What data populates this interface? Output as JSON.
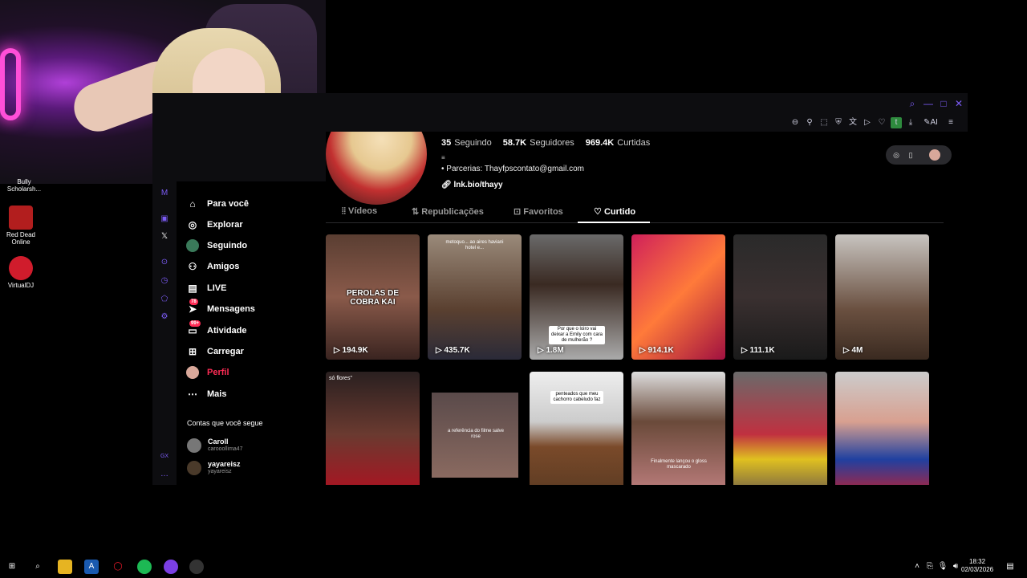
{
  "desktop": {
    "icons": [
      {
        "label": "Bully\nScholarsh..."
      },
      {
        "label": "Red Dead\nOnline"
      },
      {
        "label": "VirtualDJ"
      }
    ]
  },
  "tiktok_nav": {
    "items": [
      {
        "label": "Para você",
        "icon": "home-icon"
      },
      {
        "label": "Explorar",
        "icon": "compass-icon"
      },
      {
        "label": "Seguindo",
        "icon": "following-icon"
      },
      {
        "label": "Amigos",
        "icon": "friends-icon"
      },
      {
        "label": "LIVE",
        "icon": "live-icon"
      },
      {
        "label": "Mensagens",
        "icon": "messages-icon",
        "badge": "78"
      },
      {
        "label": "Atividade",
        "icon": "activity-icon",
        "badge": "99+"
      },
      {
        "label": "Carregar",
        "icon": "upload-icon"
      },
      {
        "label": "Perfil",
        "icon": "profile-icon"
      },
      {
        "label": "Mais",
        "icon": "more-icon"
      }
    ],
    "following_title": "Contas que você segue",
    "following": [
      {
        "name": "Caroll",
        "handle": "carooollima47"
      },
      {
        "name": "yayareisz",
        "handle": "yayareisz"
      }
    ]
  },
  "profile": {
    "stats": [
      {
        "value": "35",
        "label": "Seguindo"
      },
      {
        "value": "58.7K",
        "label": "Seguidores"
      },
      {
        "value": "969.4K",
        "label": "Curtidas"
      }
    ],
    "bio_icon": "≡",
    "bio": "• Parcerias: Thayfpscontato@gmail.com",
    "link": "lnk.bio/thayy",
    "tabs": [
      {
        "label": "Vídeos",
        "icon": "grid-icon"
      },
      {
        "label": "Republicações",
        "icon": "repost-icon"
      },
      {
        "label": "Favoritos",
        "icon": "bookmark-icon"
      },
      {
        "label": "Curtido",
        "icon": "heart-icon"
      }
    ],
    "active_tab": "Curtido"
  },
  "videos": [
    {
      "views": "194.9K",
      "overlay": "PEROLAS DE COBRA KAI"
    },
    {
      "views": "435.7K",
      "caption": "metoquo... ao aires haviani hotel e..."
    },
    {
      "views": "1.8M",
      "caption": "Por que o loiro vai deixar a Emily com cara de mulherão ?"
    },
    {
      "views": "914.1K"
    },
    {
      "views": "111.1K"
    },
    {
      "views": "4M"
    },
    {
      "caption_top": "só flores\""
    },
    {
      "caption": "a referência do filme salve rose"
    },
    {
      "caption": "penteados que meu cachorro cabeludo faz"
    },
    {
      "caption": "Finalmente lançou o gloss mascarado"
    },
    {},
    {}
  ],
  "taskbar": {
    "time": "18:32",
    "date": "02/03/2026"
  }
}
